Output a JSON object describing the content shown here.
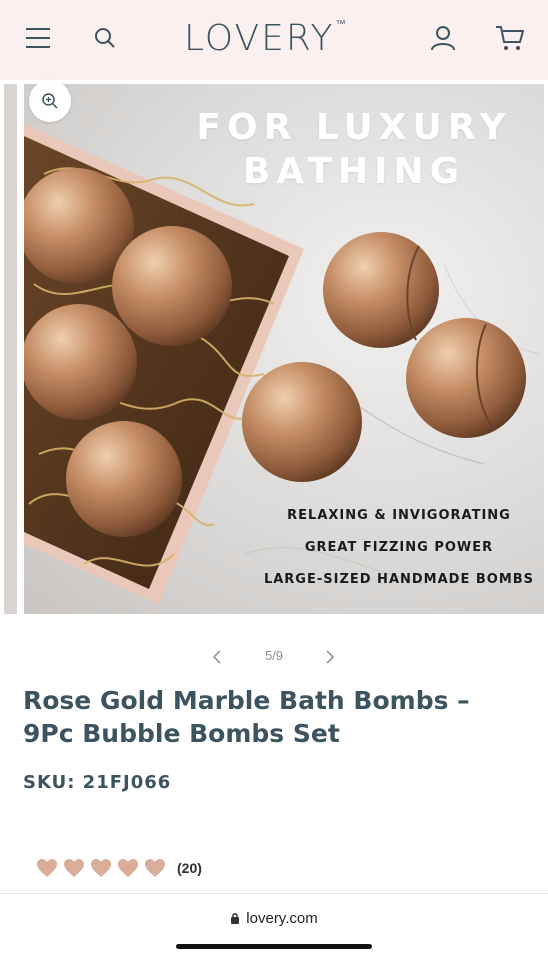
{
  "header": {
    "brand": "LOVERY",
    "trademark": "™",
    "icons": {
      "menu": "hamburger-menu-icon",
      "search": "search-icon",
      "account": "user-icon",
      "cart": "cart-icon"
    },
    "background": "#faf0ef"
  },
  "gallery": {
    "headline_line1": "FOR LUXURY",
    "headline_line2": "BATHING",
    "features": [
      "RELAXING & INVIGORATING",
      "GREAT FIZZING POWER",
      "LARGE-SIZED HANDMADE BOMBS"
    ],
    "zoom_icon": "zoom-in-icon",
    "pager": {
      "current": 5,
      "total": 9,
      "label": "5/9"
    }
  },
  "product": {
    "title": "Rose Gold Marble Bath Bombs – 9Pc Bubble Bombs Set",
    "sku": "SKU: 21FJ066",
    "rating": {
      "hearts": 5,
      "count_label": "(20)",
      "heart_color": "#d9ad9a"
    }
  },
  "browser": {
    "url": "lovery.com"
  },
  "colors": {
    "brand_text": "#3d5360",
    "accent": "#d9ad9a"
  }
}
